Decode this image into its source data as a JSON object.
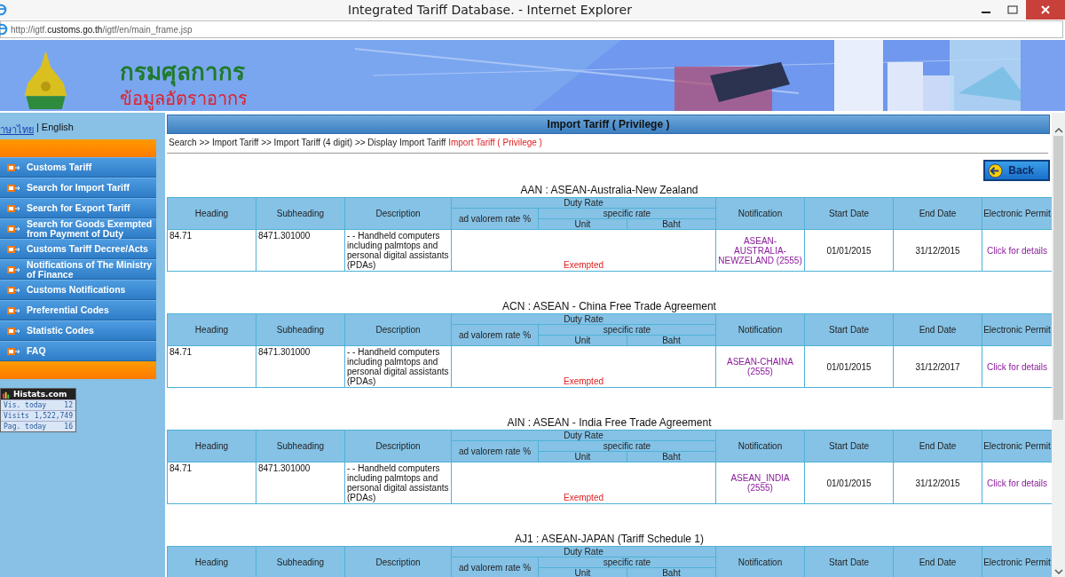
{
  "window": {
    "title": "Integrated Tariff Database. - Internet Explorer"
  },
  "address_bar": {
    "url_prefix": "http://igtf.",
    "url_domain": "customs.go.th",
    "url_path": "/igtf/en/main_frame.jsp"
  },
  "banner": {
    "title": "กรมศุลกากร",
    "subtitle": "ข้อมูลอัตราอากร"
  },
  "sidebar": {
    "languages": [
      {
        "label": "าษาไทย",
        "selected": false
      },
      {
        "label": "English",
        "selected": true
      }
    ],
    "separator": "|",
    "items": [
      {
        "label": "Customs Tariff"
      },
      {
        "label": "Search for Import Tariff"
      },
      {
        "label": "Search for Export Tariff"
      },
      {
        "label": "Search for Goods Exempted from Payment of Duty"
      },
      {
        "label": "Customs Tariff Decree/Acts"
      },
      {
        "label": "Notifications of The Ministry of Finance"
      },
      {
        "label": "Customs Notifications"
      },
      {
        "label": "Preferential Codes"
      },
      {
        "label": "Statistic Codes"
      },
      {
        "label": "FAQ"
      }
    ],
    "counter": {
      "title": "Histats.com",
      "rows": [
        {
          "label": "Vis. today",
          "value": "12"
        },
        {
          "label": "Visits",
          "value": "1,522,749"
        },
        {
          "label": "Pag. today",
          "value": "16"
        }
      ]
    }
  },
  "page": {
    "title": "Import Tariff ( Privilege )",
    "breadcrumb": "Search >> Import Tariff >> Import Tariff (4 digit) >> Display Import Tariff",
    "breadcrumb_current": "Import Tariff ( Privilege )",
    "back_button": "Back"
  },
  "sections": [
    {
      "title": "AAN : ASEAN-Australia-New Zealand",
      "columns": {
        "heading": "Heading",
        "subheading": "Subheading",
        "description": "Description",
        "duty_rate": "Duty Rate",
        "ad_valorem": "ad valorem rate %",
        "specific_rate": "specific rate",
        "unit": "Unit",
        "baht": "Baht",
        "notification": "Notification",
        "start_date": "Start Date",
        "end_date": "End Date",
        "permit": "Electronic Permit"
      },
      "rows": [
        {
          "heading": "84.71",
          "subheading": "8471.301000",
          "description": "- - Handheld computers including palmtops and personal digital assistants (PDAs)",
          "status": "Exempted",
          "notification": "ASEAN-AUSTRALIA-NEWZELAND (2555)",
          "start_date": "01/01/2015",
          "end_date": "31/12/2015",
          "permit": "Click for details"
        }
      ]
    },
    {
      "title": "ACN : ASEAN - China Free Trade Agreement",
      "columns": {
        "heading": "Heading",
        "subheading": "Subheading",
        "description": "Description",
        "duty_rate": "Duty Rate",
        "ad_valorem": "ad valorem rate %",
        "specific_rate": "specific rate",
        "unit": "Unit",
        "baht": "Baht",
        "notification": "Notification",
        "start_date": "Start Date",
        "end_date": "End Date",
        "permit": "Electronic Permit"
      },
      "rows": [
        {
          "heading": "84.71",
          "subheading": "8471.301000",
          "description": "- - Handheld computers including palmtops and personal digital assistants (PDAs)",
          "status": "Exempted",
          "notification": "ASEAN-CHAINA (2555)",
          "start_date": "01/01/2015",
          "end_date": "31/12/2017",
          "permit": "Click for details"
        }
      ]
    },
    {
      "title": "AIN : ASEAN - India Free Trade Agreement",
      "columns": {
        "heading": "Heading",
        "subheading": "Subheading",
        "description": "Description",
        "duty_rate": "Duty Rate",
        "ad_valorem": "ad valorem rate %",
        "specific_rate": "specific rate",
        "unit": "Unit",
        "baht": "Baht",
        "notification": "Notification",
        "start_date": "Start Date",
        "end_date": "End Date",
        "permit": "Electronic Permit"
      },
      "rows": [
        {
          "heading": "84.71",
          "subheading": "8471.301000",
          "description": "- - Handheld computers including palmtops and personal digital assistants (PDAs)",
          "status": "Exempted",
          "notification": "ASEAN_INDIA (2555)",
          "start_date": "01/01/2015",
          "end_date": "31/12/2015",
          "permit": "Click for details"
        }
      ]
    },
    {
      "title": "AJ1 : ASEAN-JAPAN (Tariff Schedule 1)",
      "columns": {
        "heading": "Heading",
        "subheading": "Subheading",
        "description": "Description",
        "duty_rate": "Duty Rate",
        "ad_valorem": "ad valorem rate %",
        "specific_rate": "specific rate",
        "unit": "Unit",
        "baht": "Baht",
        "notification": "Notification",
        "start_date": "Start Date",
        "end_date": "End Date",
        "permit": "Electronic Permit"
      }
    }
  ]
}
